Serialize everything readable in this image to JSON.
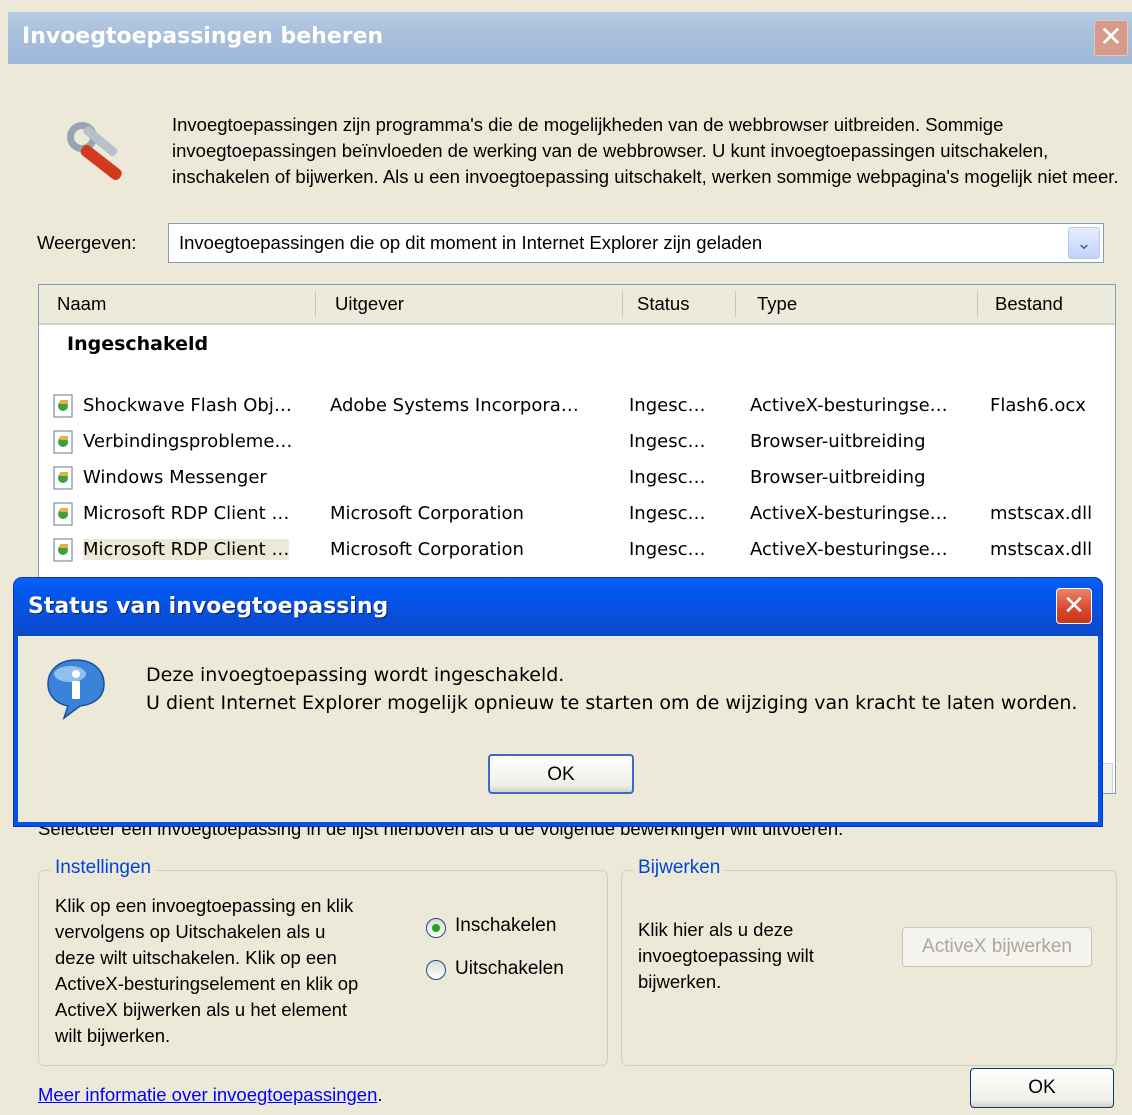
{
  "main_window": {
    "title": "Invoegtoepassingen beheren",
    "close_glyph": "✕",
    "description": "Invoegtoepassingen zijn programma's die de mogelijkheden van de webbrowser uitbreiden. Sommige invoegtoepassingen beïnvloeden de werking van de webbrowser. U kunt invoegtoepassingen uitschakelen, inschakelen of bijwerken. Als u een invoegtoepassing uitschakelt, werken sommige webpagina's mogelijk niet meer.",
    "show_label": "Weergeven:",
    "show_value": "Invoegtoepassingen die op dit moment in Internet Explorer zijn geladen",
    "dropdown_arrow": "⌄"
  },
  "list": {
    "columns": [
      "Naam",
      "Uitgever",
      "Status",
      "Type",
      "Bestand"
    ],
    "group_label": "Ingeschakeld",
    "rows": [
      {
        "name": "Shockwave Flash Obj…",
        "publisher": "Adobe Systems Incorpora…",
        "status": "Ingesc…",
        "type": "ActiveX-besturingse…",
        "file": "Flash6.ocx"
      },
      {
        "name": "Verbindingsprobleme…",
        "publisher": "",
        "status": "Ingesc…",
        "type": "Browser-uitbreiding",
        "file": ""
      },
      {
        "name": "Windows Messenger",
        "publisher": "",
        "status": "Ingesc…",
        "type": "Browser-uitbreiding",
        "file": ""
      },
      {
        "name": "Microsoft RDP Client …",
        "publisher": "Microsoft Corporation",
        "status": "Ingesc…",
        "type": "ActiveX-besturingse…",
        "file": "mstscax.dll"
      },
      {
        "name": "Microsoft RDP Client …",
        "publisher": "Microsoft Corporation",
        "status": "Ingesc…",
        "type": "ActiveX-besturingse…",
        "file": "mstscax.dll"
      }
    ]
  },
  "hint": "Selecteer een invoegtoepassing in de lijst hierboven als u de volgende bewerkingen wilt uitvoeren.",
  "settings": {
    "legend": "Instellingen",
    "text_lines": [
      "Klik op een invoegtoepassing en klik",
      "vervolgens op Uitschakelen als u",
      "deze wilt uitschakelen. Klik op een",
      "ActiveX-besturingselement en klik op",
      "ActiveX bijwerken als u het element",
      "wilt bijwerken."
    ],
    "radio_enable": "Inschakelen",
    "radio_disable": "Uitschakelen",
    "selected": "Inschakelen"
  },
  "update": {
    "legend": "Bijwerken",
    "text_lines": [
      "Klik hier als u deze",
      "invoegtoepassing wilt",
      "bijwerken."
    ],
    "button": "ActiveX bijwerken"
  },
  "more_info_link": "Meer informatie over invoegtoepassingen",
  "more_info_period": ".",
  "ok_button": "OK",
  "modal": {
    "title": "Status van invoegtoepassing",
    "close_glyph": "✕",
    "line1": "Deze invoegtoepassing wordt ingeschakeld.",
    "line2": "U dient Internet Explorer mogelijk opnieuw te starten om de wijziging van kracht te laten worden.",
    "ok": "OK"
  },
  "colors": {
    "modal_titlebar": "#0058ee",
    "dialog_face": "#ece9d8",
    "link": "#0000ff",
    "legend": "#0046d5"
  }
}
